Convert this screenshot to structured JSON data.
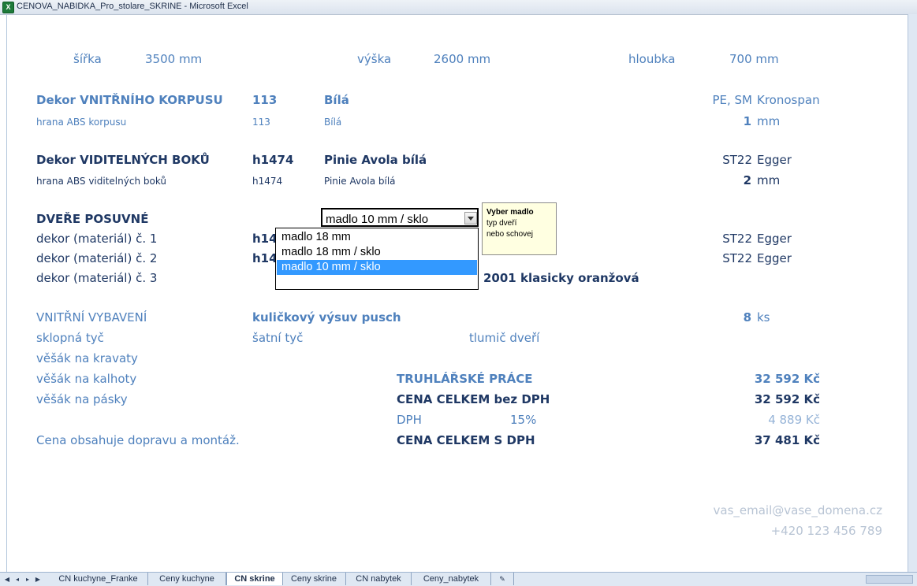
{
  "window": {
    "title": "CENOVA_NABIDKA_Pro_stolare_SKRINE - Microsoft Excel"
  },
  "dimensions": {
    "width_label": "šířka",
    "width_value": "3500 mm",
    "height_label": "výška",
    "height_value": "2600 mm",
    "depth_label": "hloubka",
    "depth_value": "700 mm"
  },
  "inner_decor": {
    "label": "Dekor VNITŘNÍHO KORPUSU",
    "code": "113",
    "name": "Bílá",
    "type": "PE, SM",
    "brand": "Kronospan",
    "edge_label": "hrana ABS korpusu",
    "edge_code": "113",
    "edge_name": "Bílá",
    "edge_thickness": "1",
    "edge_unit": "mm"
  },
  "visible_decor": {
    "label": "Dekor VIDITELNÝCH BOKŮ",
    "code": "h1474",
    "name": "Pinie Avola bílá",
    "type": "ST22",
    "brand": "Egger",
    "edge_label": "hrana ABS viditelných boků",
    "edge_code": "h1474",
    "edge_name": "Pinie Avola bílá",
    "edge_thickness": "2",
    "edge_unit": "mm"
  },
  "doors": {
    "label": "DVEŘE POSUVNÉ",
    "rows": [
      {
        "label": "dekor (materiál) č. 1",
        "code": "h14",
        "type": "ST22",
        "brand": "Egger"
      },
      {
        "label": "dekor (materiál) č. 2",
        "code": "h14",
        "type": "ST22",
        "brand": "Egger"
      },
      {
        "label": "dekor (materiál) č. 3",
        "name": "2001 klasicky oranžová"
      }
    ]
  },
  "handle_combo": {
    "value": "madlo 10 mm / sklo",
    "options": [
      "madlo 18 mm",
      "madlo 18 mm / sklo",
      "madlo 10 mm / sklo"
    ],
    "selected_index": 2
  },
  "tooltip": {
    "title": "Vyber madlo",
    "line1": "typ dveří",
    "line2": "nebo schovej"
  },
  "interior": {
    "label": "VNITŘNÍ VYBAVENÍ",
    "item": "kuličkový výsuv pusch",
    "qty": "8",
    "qty_unit": "ks",
    "row1": [
      "sklopná tyč",
      "šatní tyč",
      "tlumič dveří"
    ],
    "rack_ties": "věšák na kravaty",
    "rack_trousers": "věšák na kalhoty",
    "rack_belts": "věšák na pásky"
  },
  "pricing": {
    "work_label": "TRUHLÁŘSKÉ PRÁCE",
    "work_value": "32 592 Kč",
    "total_no_vat_label": "CENA CELKEM bez DPH",
    "total_no_vat_value": "32 592 Kč",
    "vat_label": "DPH",
    "vat_rate": "15%",
    "vat_value": "4 889 Kč",
    "total_vat_label": "CENA CELKEM S DPH",
    "total_vat_value": "37 481 Kč"
  },
  "note": "Cena obsahuje dopravu a montáž.",
  "contact": {
    "email": "vas_email@vase_domena.cz",
    "phone": "+420 123 456 789"
  },
  "sheet_tabs": [
    {
      "label": "CN kuchyne_Franke",
      "active": false
    },
    {
      "label": "Ceny kuchyne",
      "active": false
    },
    {
      "label": "CN skrine",
      "active": true
    },
    {
      "label": "Ceny skrine",
      "active": false
    },
    {
      "label": "CN nabytek",
      "active": false
    },
    {
      "label": "Ceny_nabytek",
      "active": false
    }
  ],
  "colors": {
    "accent_blue": "#4f81bd",
    "dark_navy": "#1f3864",
    "selection": "#3399ff"
  }
}
